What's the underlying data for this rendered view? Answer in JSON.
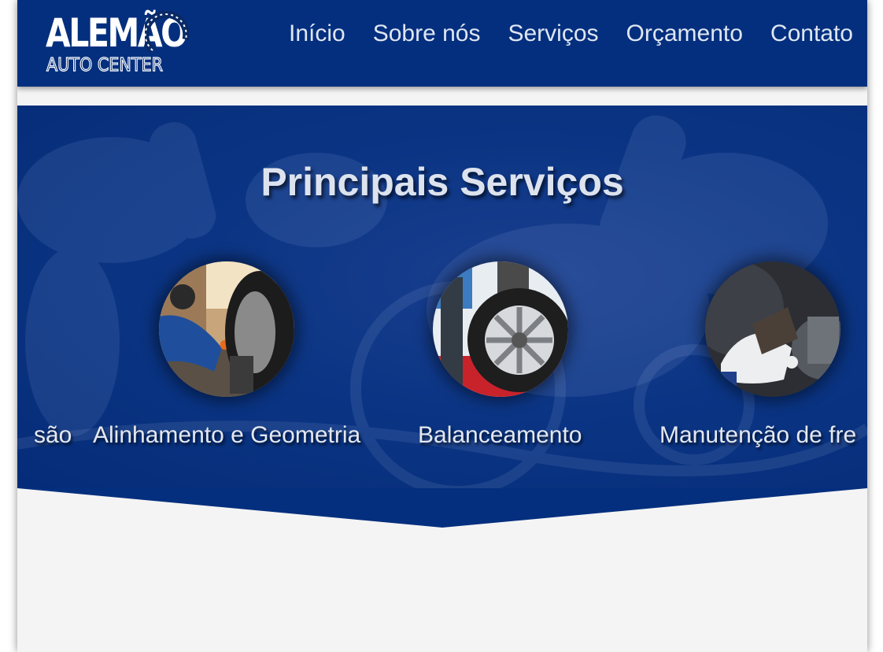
{
  "header": {
    "logo_main": "ALEMÃO",
    "logo_sub": "AUTO CENTER",
    "nav": [
      "Início",
      "Sobre nós",
      "Serviços",
      "Orçamento",
      "Contato"
    ]
  },
  "hero": {
    "title": "Principais Serviços",
    "services": [
      {
        "label": "são"
      },
      {
        "label": "Alinhamento e Geometria",
        "image": "alignment-photo"
      },
      {
        "label": "Balanceamento",
        "image": "balancing-photo"
      },
      {
        "label": "Manutenção de fre",
        "image": "brake-pad-photo"
      }
    ]
  },
  "colors": {
    "brand_blue": "#042f7e",
    "page_bg": "#f4f4f4",
    "nav_text": "#dfe6f2"
  }
}
